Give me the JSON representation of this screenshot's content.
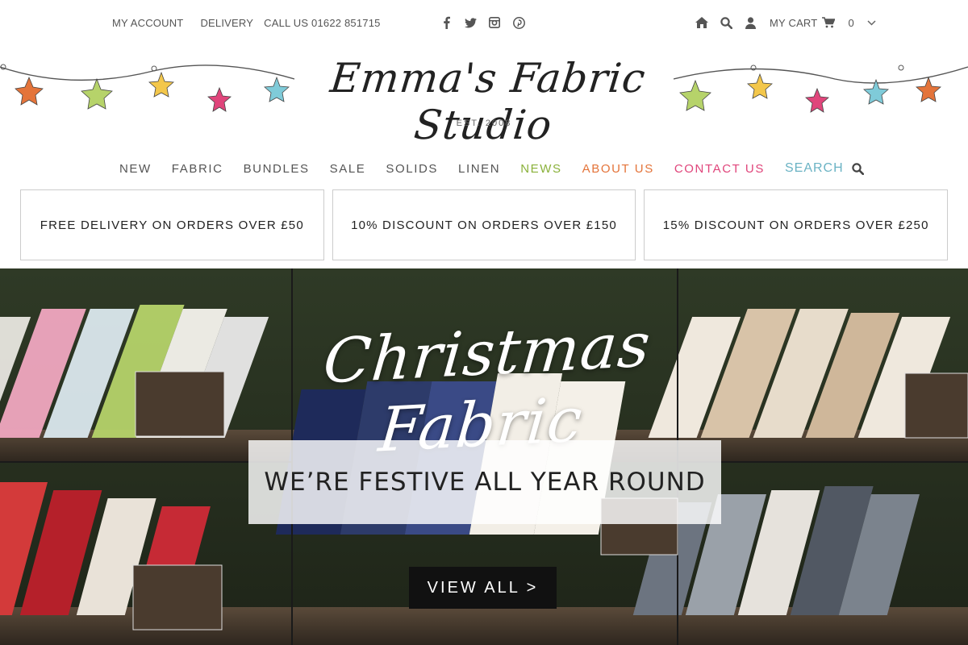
{
  "topbar": {
    "my_account": "MY ACCOUNT",
    "delivery": "DELIVERY",
    "call_us": "CALL US 01622 851715",
    "social_icons": [
      "facebook-icon",
      "twitter-icon",
      "instagram-icon",
      "pinterest-icon"
    ],
    "my_cart": "MY CART",
    "cart_count": "0"
  },
  "header": {
    "logo": "Emma's Fabric Studio",
    "est": "EST. 2008"
  },
  "nav": {
    "items": [
      "NEW",
      "FABRIC",
      "BUNDLES",
      "SALE",
      "SOLIDS",
      "LINEN",
      "NEWS",
      "ABOUT US",
      "CONTACT US"
    ],
    "search": "SEARCH"
  },
  "promos": [
    "FREE DELIVERY ON ORDERS OVER £50",
    "10% DISCOUNT ON ORDERS OVER £150",
    "15% DISCOUNT ON ORDERS OVER £250"
  ],
  "hero": {
    "title": "Christmas Fabric",
    "tagline": "WE’RE FESTIVE ALL YEAR ROUND",
    "button": "VIEW ALL >"
  },
  "colors": {
    "news": "#8ab13a",
    "about": "#e4743a",
    "contact": "#e0457b",
    "search": "#6bb3c4"
  }
}
